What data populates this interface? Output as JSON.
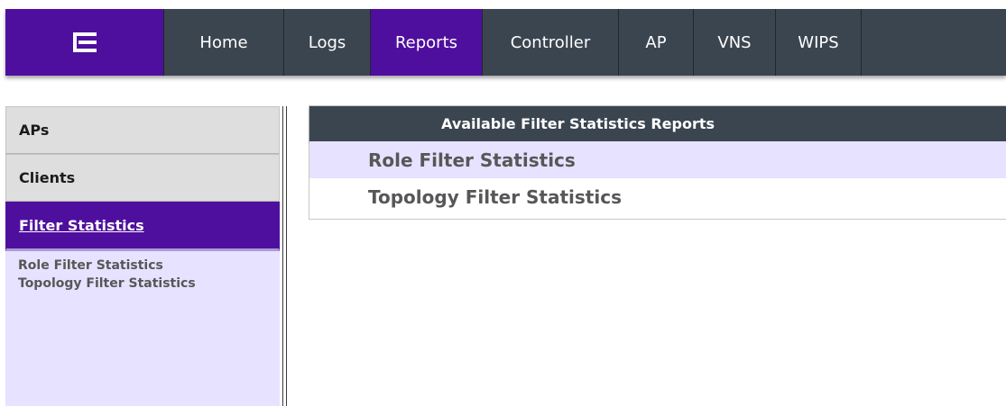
{
  "colors": {
    "brand": "#4f0f9e",
    "nav_bg": "#3b4550",
    "sidebar_bg": "#e7e2ff",
    "row_highlight": "#e7e2ff"
  },
  "nav": {
    "logo_icon": "extreme-logo-icon",
    "items": [
      {
        "label": "Home"
      },
      {
        "label": "Logs"
      },
      {
        "label": "Reports"
      },
      {
        "label": "Controller"
      },
      {
        "label": "AP"
      },
      {
        "label": "VNS"
      },
      {
        "label": "WIPS"
      }
    ],
    "active": "Reports"
  },
  "sidebar": {
    "tabs": [
      {
        "label": "APs"
      },
      {
        "label": "Clients"
      },
      {
        "label": "Filter Statistics"
      }
    ],
    "active": "Filter Statistics",
    "links": [
      {
        "label": "Role Filter Statistics"
      },
      {
        "label": "Topology Filter Statistics"
      }
    ]
  },
  "main": {
    "table_header": "Available Filter Statistics Reports",
    "rows": [
      {
        "label": "Role Filter Statistics"
      },
      {
        "label": "Topology Filter Statistics"
      }
    ]
  }
}
